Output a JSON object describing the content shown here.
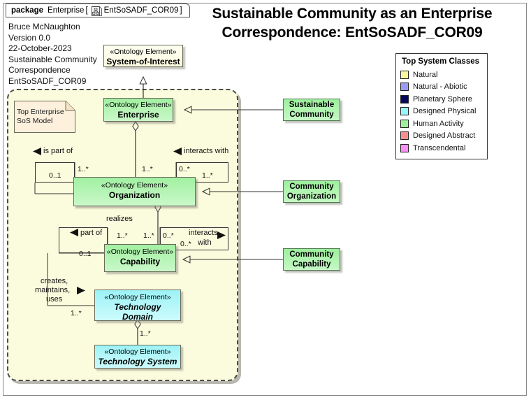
{
  "window": {
    "package_keyword": "package",
    "package_name": "Enterprise",
    "bracket_open": "[",
    "bracket_close": "]",
    "diagram_ref": "EntSoSADF_COR09",
    "diagram_icon": "diagram-hierarchy-icon"
  },
  "title": {
    "line1": "Sustainable Community as an Enterprise",
    "line2": "Correspondence:  EntSoSADF_COR09"
  },
  "meta": {
    "line1": "Bruce McNaughton",
    "line2": "Version 0.0",
    "line3": "22-October-2023",
    "line4": "Sustainable Community",
    "line5": "Correspondence",
    "line6": "EntSoSADF_COR09"
  },
  "legend": {
    "title": "Top System Classes",
    "items": [
      {
        "label": "Natural",
        "color": "#fbf7a0"
      },
      {
        "label": "Natural - Abiotic",
        "color": "#9a9af2"
      },
      {
        "label": "Planetary Sphere",
        "color": "#070761"
      },
      {
        "label": "Designed Physical",
        "color": "#96f6fb"
      },
      {
        "label": "Human Activity",
        "color": "#9cf09c"
      },
      {
        "label": "Designed Abstract",
        "color": "#f79090"
      },
      {
        "label": "Transcendental",
        "color": "#f78ff7"
      }
    ]
  },
  "note": {
    "line1": "Top Enterprise",
    "line2": "SoS Model"
  },
  "classes": {
    "system_of_interest": {
      "stereotype": "«Ontology Element»",
      "name": "System-of-Interest",
      "fill": "cream",
      "italic": false
    },
    "enterprise": {
      "stereotype": "«Ontology Element»",
      "name": "Enterprise",
      "fill": "green",
      "italic": false
    },
    "organization": {
      "stereotype": "«Ontology Element»",
      "name": "Organization",
      "fill": "green",
      "italic": false
    },
    "capability": {
      "stereotype": "«Ontology Element»",
      "name": "Capability",
      "fill": "green",
      "italic": false
    },
    "technology_domain": {
      "stereotype": "«Ontology Element»",
      "name_line1": "Technology",
      "name_line2": "Domain",
      "fill": "cyan",
      "italic": true
    },
    "technology_system": {
      "stereotype": "«Ontology Element»",
      "name": "Technology System",
      "fill": "cyan",
      "italic": true
    }
  },
  "refs": {
    "sustainable_community": {
      "line1": "Sustainable",
      "line2": "Community"
    },
    "community_organization": {
      "line1": "Community",
      "line2": "Organization"
    },
    "community_capability": {
      "line1": "Community",
      "line2": "Capability"
    }
  },
  "relations": {
    "org_is_part_of": "is part of",
    "org_interacts_with": "interacts with",
    "cap_part_of": "part of",
    "cap_interacts_line1": "interacts",
    "cap_interacts_line2": "with",
    "realizes": "realizes",
    "creates_line1": "creates,",
    "creates_line2": "maintains,",
    "creates_line3": "uses"
  },
  "multiplicities": {
    "org_part_many": "1..*",
    "org_part_one": "0..1",
    "org_ent_many": "1..*",
    "org_int_zero": "0..*",
    "org_int_many": "1..*",
    "cap_part_many": "1..*",
    "cap_part_one": "0..1",
    "cap_real_many": "1..*",
    "cap_int_zero_a": "0..*",
    "cap_int_zero_b": "0..*",
    "td_from_cap": "1..*",
    "ts_from_td": "1..*"
  }
}
